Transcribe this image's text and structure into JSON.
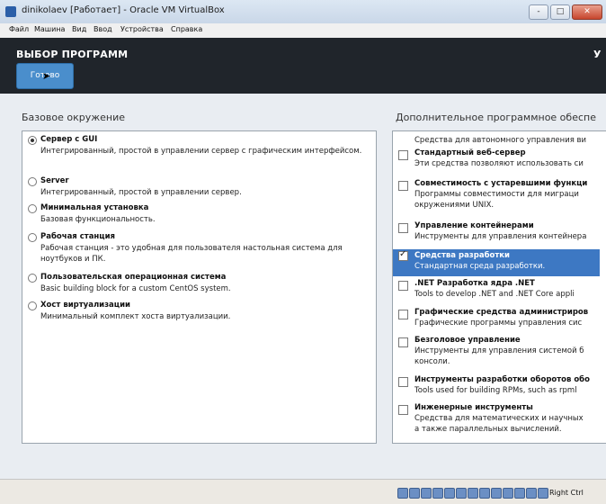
{
  "window": {
    "title": "dinikolaev [Работает] - Oracle VM VirtualBox",
    "controls": {
      "minimize": "-",
      "maximize": "□",
      "close": "✕"
    }
  },
  "menu": [
    "Файл",
    "Машина",
    "Вид",
    "Ввод",
    "Устройства",
    "Справка"
  ],
  "header": {
    "heading": "ВЫБОР ПРОГРАММ",
    "done_button": "Готово",
    "right_fragment": "У"
  },
  "left": {
    "label": "Базовое окружение",
    "selected_index": 0,
    "items": [
      {
        "title": "Сервер с GUI",
        "desc": "Интегрированный, простой в управлении сервер с графическим интерфейсом."
      },
      {
        "title": "Server",
        "desc": "Интегрированный, простой в управлении сервер."
      },
      {
        "title": "Минимальная установка",
        "desc": "Базовая функциональность."
      },
      {
        "title": "Рабочая станция",
        "desc": "Рабочая станция - это удобная для пользователя настольная система для ноутбуков и ПК."
      },
      {
        "title": "Пользовательская операционная система",
        "desc": "Basic building block for a custom CentOS system."
      },
      {
        "title": "Хост виртуализации",
        "desc": "Минимальный комплект хоста виртуализации."
      }
    ]
  },
  "right": {
    "label": "Дополнительное программное обеспе",
    "partial_top": "Средства для автономного управления ви",
    "items": [
      {
        "title": "Стандартный веб-сервер",
        "desc1": "Эти средства позволяют использовать си",
        "desc2": "",
        "checked": false,
        "selected": false
      },
      {
        "title": "Совместимость с устаревшими функци",
        "desc1": "Программы совместимости для миграци",
        "desc2": "окружениями UNIX.",
        "checked": false,
        "selected": false
      },
      {
        "title": "Управление контейнерами",
        "desc1": "Инструменты для управления контейнера",
        "desc2": "",
        "checked": false,
        "selected": false
      },
      {
        "title": "Средства разработки",
        "desc1": "Стандартная среда разработки.",
        "desc2": "",
        "checked": true,
        "selected": true
      },
      {
        "title": ".NET Разработка ядра .NET",
        "desc1": "Tools to develop .NET and .NET Core appli",
        "desc2": "",
        "checked": false,
        "selected": false
      },
      {
        "title": "Графические средства администриров",
        "desc1": "Графические программы управления сис",
        "desc2": "",
        "checked": false,
        "selected": false
      },
      {
        "title": "Безголовое управление",
        "desc1": "Инструменты для управления системой б",
        "desc2": "консоли.",
        "checked": false,
        "selected": false
      },
      {
        "title": "Инструменты разработки оборотов обо",
        "desc1": "Tools used for building RPMs, such as rpml",
        "desc2": "",
        "checked": false,
        "selected": false
      },
      {
        "title": "Инженерные инструменты",
        "desc1": "Средства для математических и научных",
        "desc2": "а также параллельных вычислений.",
        "checked": false,
        "selected": false
      }
    ]
  },
  "statusbar": {
    "host_key": "Right Ctrl"
  }
}
